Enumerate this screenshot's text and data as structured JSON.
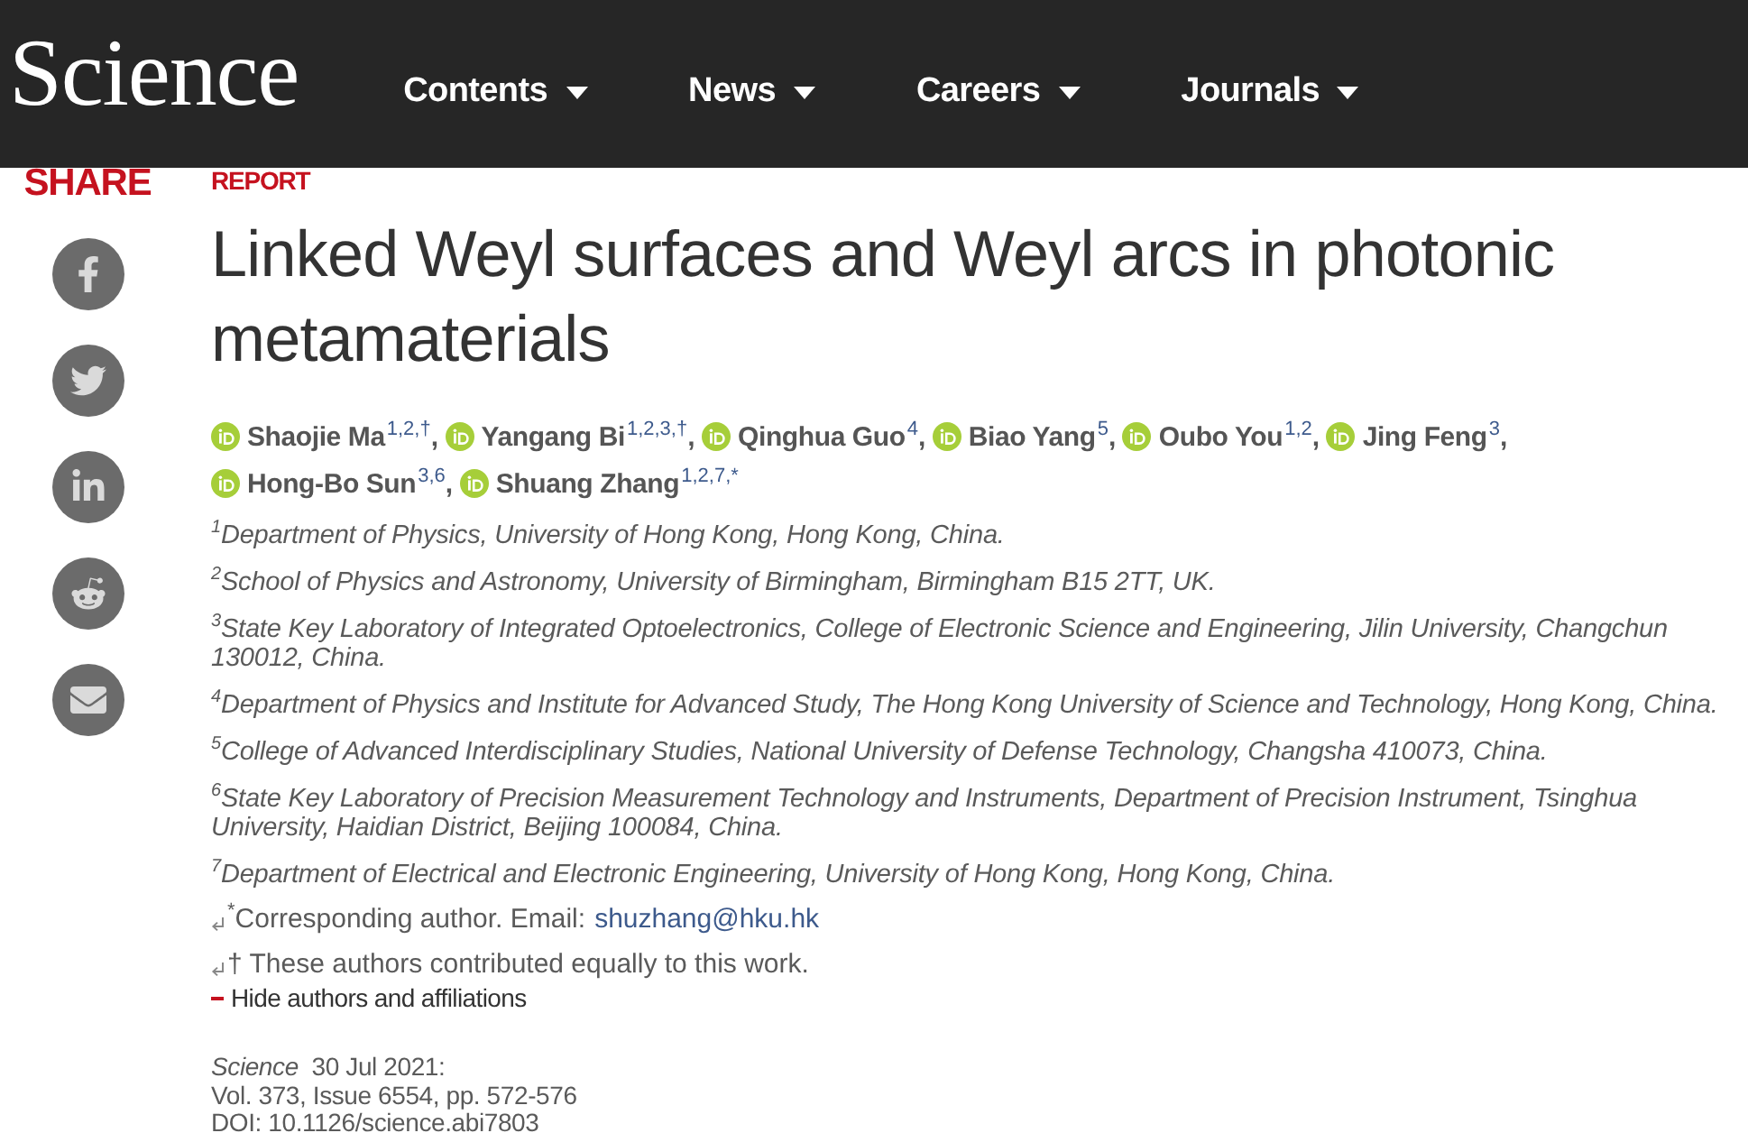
{
  "header": {
    "logo": "Science",
    "nav": [
      {
        "label": "Contents"
      },
      {
        "label": "News"
      },
      {
        "label": "Careers"
      },
      {
        "label": "Journals"
      }
    ]
  },
  "share": {
    "title": "SHARE",
    "networks": [
      {
        "kind": "facebook"
      },
      {
        "kind": "twitter"
      },
      {
        "kind": "linkedin"
      },
      {
        "kind": "reddit"
      },
      {
        "kind": "email"
      }
    ]
  },
  "article": {
    "type": "REPORT",
    "title": "Linked Weyl surfaces and Weyl arcs in photonic metamaterials",
    "authors": [
      {
        "name": "Shaojie Ma",
        "marks": "1,2,†",
        "separator": ","
      },
      {
        "name": "Yangang Bi",
        "marks": "1,2,3,†",
        "separator": ","
      },
      {
        "name": "Qinghua Guo",
        "marks": "4",
        "separator": ","
      },
      {
        "name": "Biao Yang",
        "marks": "5",
        "separator": ","
      },
      {
        "name": "Oubo You",
        "marks": "1,2",
        "separator": ","
      },
      {
        "name": "Jing Feng",
        "marks": "3",
        "separator": ","
      },
      {
        "name": "Hong-Bo Sun",
        "marks": "3,6",
        "separator": ","
      },
      {
        "name": "Shuang Zhang",
        "marks": "1,2,7,*"
      }
    ],
    "affiliations": [
      "$^{1}$Department of Physics, University of Hong Kong, Hong Kong, China.",
      "$^{2}$School of Physics and Astronomy, University of Birmingham, Birmingham B15 2TT, UK.",
      "$^{3}$State Key Laboratory of Integrated Optoelectronics, College of Electronic Science and Engineering, Jilin University, Changchun 130012, China.",
      "$^{4}$Department of Physics and Institute for Advanced Study, The Hong Kong University of Science and Technology, Hong Kong, China.",
      "$^{5}$College of Advanced Interdisciplinary Studies, National University of Defense Technology, Changsha 410073, China.",
      "$^{6}$State Key Laboratory of Precision Measurement Technology and Instruments, Department of Precision Instrument, Tsinghua University, Haidian District, Beijing 100084, China.",
      "$^{7}$Department of Electrical and Electronic Engineering, University of Hong Kong, Hong Kong, China."
    ],
    "notes": [
      {
        "text": "$^{*}$Corresponding author. Email:",
        "email": "shuzhang@hku.hk"
      },
      {
        "text": "† These authors contributed equally to this work."
      }
    ],
    "toggle": {
      "label": "Hide authors and affiliations",
      "expanded": true
    },
    "citation": {
      "published": "*Science*  30 Jul 2021:",
      "issue": "Vol. 373, Issue 6554, pp. 572-576",
      "doi": "DOI: 10.1126/science.abi7803"
    }
  }
}
